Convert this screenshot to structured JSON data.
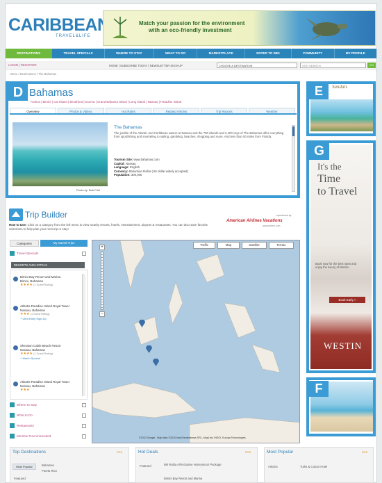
{
  "header": {
    "logo": "CARIBBEAN",
    "logo_sub": "TRAVEL&LIFE",
    "banner_text_line1": "Match your passion for the environment",
    "banner_text_line2": "with an eco-friendly investment"
  },
  "nav": {
    "items": [
      "DESTINATIONS",
      "TRAVEL SPECIALS",
      "WHERE TO STAY",
      "WHAT TO DO",
      "MARKETPLACE",
      "ENTER TO WIN",
      "COMMUNITY",
      "MY PROFILE"
    ],
    "active_color": "#6fba3d",
    "bar_color": "#2a83b9"
  },
  "subbar": {
    "login": "LOGIN | REGISTER",
    "links": "HOME | SUBSCRIBE TODAY | NEWSLETTER SIGN-UP",
    "dest_select": "CHOOSE A DESTINATION",
    "site_search_placeholder": "SITE SEARCH",
    "go": "GO"
  },
  "breadcrumb": "Home / Destinations / The Bahamas",
  "section_d": {
    "label": "D",
    "title": "Bahamas",
    "islands": "Andros | Bimini | Cat Island | Eleuthera | Exuma | Grand Bahama Island | Long Island | Nassau | Paradise Island",
    "tabs": [
      "Overview",
      "Photos & Videos",
      "Hot Rates",
      "Related Articles",
      "Trip Reports",
      "Weather"
    ],
    "photo_caption": "Photo by: Bob Friel",
    "info_title": "The Bahamas",
    "info_text": "The jumble of the Atlantic and Caribbean waters at Nassau and the 700 islands and 2,400 cays of The Bahamas offer everything from sportfishing and snorkeling to sailing, gambling, beaches, shopping and more. And less than 50 miles from Florida.",
    "facts": [
      {
        "k": "Tourism Site:",
        "v": "www.bahamas.com"
      },
      {
        "k": "Capital:",
        "v": "Nassau"
      },
      {
        "k": "Language:",
        "v": "English"
      },
      {
        "k": "Currency:",
        "v": "Bahamian Dollar (US dollar widely accepted)"
      },
      {
        "k": "Population:",
        "v": "300,000"
      }
    ]
  },
  "section_e": {
    "label": "E",
    "brand": "Sandals"
  },
  "section_g": {
    "label": "G",
    "headline_1": "It's the",
    "headline_2": "Time",
    "headline_3": "to Travel",
    "small_text": "Book now for the best rates and enjoy the luxury of Westin.",
    "button": "Book Early »",
    "brand": "WESTIN"
  },
  "section_f": {
    "label": "F"
  },
  "trip_builder": {
    "title": "Trip Builder",
    "sponsored": "sponsored by",
    "sponsor": "American Airlines Vacations",
    "sponsor_sub": "aavacations.com",
    "howto_label": "How to Use:",
    "howto_text": "Click on a category from the left menu to view nearby resorts, hotels, entertainment, airports & restaurants. You can also save favorite selections to help plan your next trip or stay!",
    "tab_categories": "Categories",
    "tab_saved": "My Saved Trips",
    "categories_top": [
      "Travel Specials"
    ],
    "resorts_bar": "RESORTS AND HOTELS",
    "hotels": [
      {
        "name": "Bimini Bay Resort and Marina",
        "loc": "Bimini, Bahamas",
        "rating": "(1 Guest Rating)",
        "link": ""
      },
      {
        "name": "Atlantis Paradise Island Royal Tower",
        "loc": "Nassau, Bahamas",
        "rating": "(1 Guest Rating)",
        "link": "+ Ultra Early Sign-Up"
      },
      {
        "name": "Sheraton Cable Beach Resort",
        "loc": "Nassau, Bahamas",
        "rating": "(1 Guest Rating)",
        "link": "+ March Special"
      },
      {
        "name": "Atlantis Paradise Island Royal Tower",
        "loc": "Nassau, Bahamas",
        "rating": "",
        "link": ""
      }
    ],
    "categories_bottom": [
      "Where to Stay",
      "What to Do",
      "Restaurants",
      "Member Recommended"
    ],
    "map_buttons": [
      "Traffic",
      "Map",
      "Satellite",
      "Terrain"
    ],
    "map_copy": "©2010 Google - Map data ©2010 Inav/Geosistemas SRL, MapLink, INEGI, Europa Technologies"
  },
  "bottom": {
    "top_destinations": "Top Destinations",
    "hot_deals": "Hot Deals",
    "most_popular": "Most Popular",
    "rss": "RSS",
    "td_tab": "Most Popular",
    "td_items": [
      "Bahamas",
      "Puerto Rico"
    ],
    "td_second": "Featured",
    "hd_label": "Featured",
    "hd_items": [
      "Bel Rubia All-Inclusive Honeymoon Package",
      "Bimini Bay Resort and Marina"
    ],
    "mp_label": "Articles",
    "mp_items": [
      "Turks & Caicos Hotel"
    ]
  },
  "colors": {
    "accent_blue": "#3b9bd4",
    "link_pink": "#b84b7d",
    "teal": "#2a9aa8",
    "westin_red": "#9a2d26"
  }
}
